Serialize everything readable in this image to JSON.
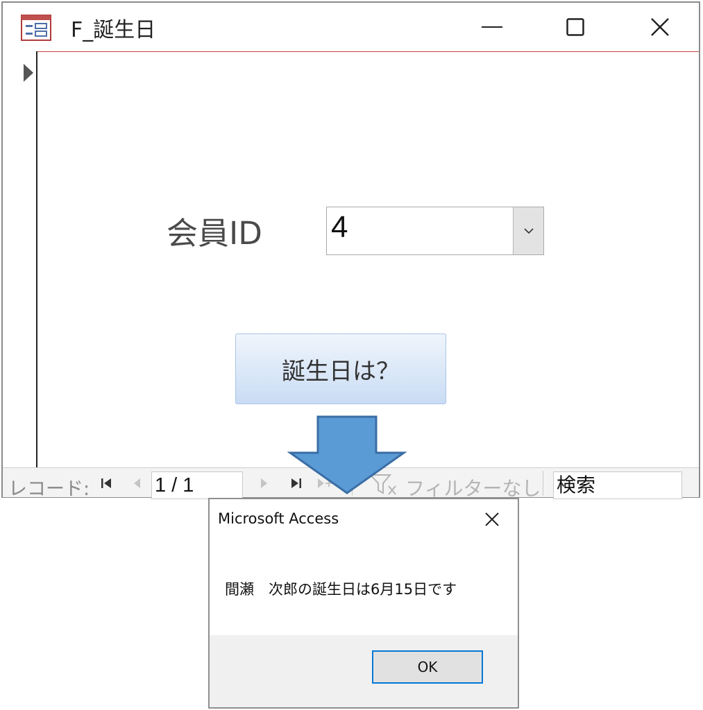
{
  "window": {
    "title": "F_誕生日",
    "icon": "form-icon",
    "controls": [
      "minimize-icon",
      "maximize-icon",
      "close-icon"
    ]
  },
  "form": {
    "member_label": "会員ID",
    "member_value": "4",
    "button_label": "誕生日は？"
  },
  "navbar": {
    "record_label": "レコード:",
    "record_position": "1 / 1",
    "filter_label": "フィルターなし",
    "search_placeholder": "検索"
  },
  "msgbox": {
    "title": "Microsoft Access",
    "message": "間瀬　次郎の誕生日は6月15日です",
    "ok_label": "OK"
  },
  "colors": {
    "titlebar_divider": "#c9423f",
    "arrow_fill": "#5b9bd5",
    "arrow_stroke": "#3b6ea5",
    "button_gradient_top": "#f0f5fc",
    "button_gradient_bottom": "#c9dcf4",
    "ok_border": "#0078d7"
  }
}
